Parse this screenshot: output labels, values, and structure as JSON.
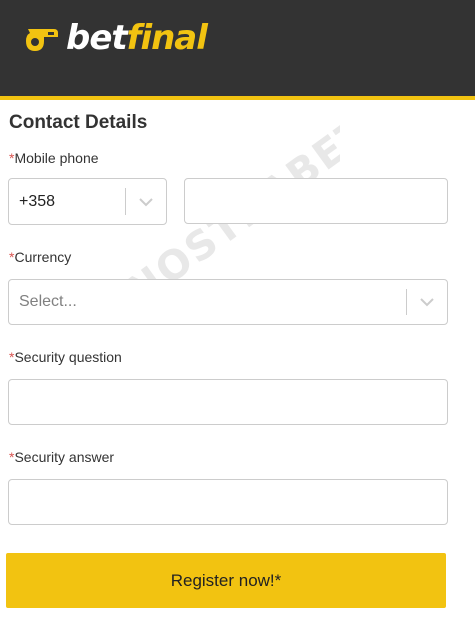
{
  "brand": {
    "logo_bet": "bet",
    "logo_final": "final",
    "accent_color": "#f2c311",
    "header_color": "#333333"
  },
  "form": {
    "title": "Contact Details",
    "required_marker": "*",
    "mobile_phone": {
      "label": "Mobile phone",
      "country_code": "+358",
      "number_value": ""
    },
    "currency": {
      "label": "Currency",
      "placeholder": "Select..."
    },
    "security_question": {
      "label": "Security question",
      "value": ""
    },
    "security_answer": {
      "label": "Security answer",
      "value": ""
    },
    "submit_label": "Register now!*"
  },
  "watermark": {
    "text": "NOSTRABET"
  }
}
